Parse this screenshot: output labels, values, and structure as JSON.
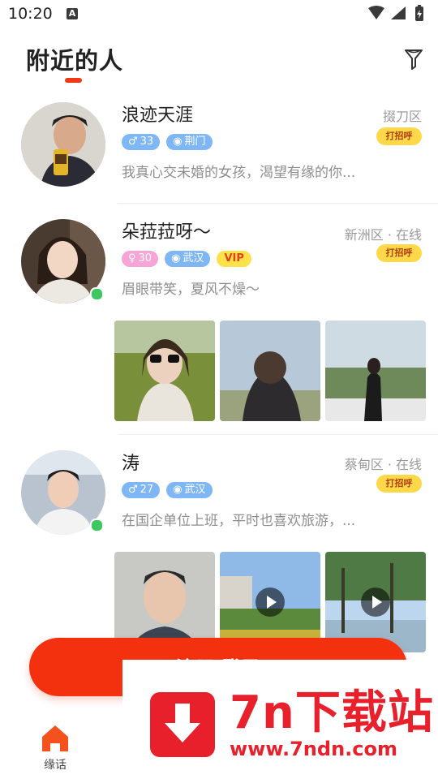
{
  "status_bar": {
    "time": "10:20"
  },
  "header": {
    "title": "附近的人"
  },
  "users": [
    {
      "name": "浪迹天涯",
      "location": "掇刀区",
      "greet_label": "打招呼",
      "gender_symbol": "♂",
      "age": "33",
      "city": "荆门",
      "bio": "我真心交未婚的女孩，渴望有缘的你..."
    },
    {
      "name": "朵菈菈呀～",
      "location": "新洲区 · 在线",
      "greet_label": "打招呼",
      "gender_symbol": "♀",
      "age": "30",
      "city": "武汉",
      "vip": "VIP",
      "bio": "眉眼带笑，夏风不燥～"
    },
    {
      "name": "涛",
      "location": "蔡甸区 · 在线",
      "greet_label": "打招呼",
      "gender_symbol": "♂",
      "age": "27",
      "city": "武汉",
      "bio": "在国企单位上班，平时也喜欢旅游，..."
    }
  ],
  "cta": {
    "label": "注册/登录"
  },
  "tabbar": {
    "home_label": "缘话"
  },
  "watermark": {
    "title": "7n下载站",
    "url": "www.7ndn.com"
  },
  "colors": {
    "accent": "#f03a17",
    "greet_bg": "#ffd84a",
    "online": "#3dc761",
    "male_tag": "#7fb6f6",
    "female_tag": "#f7a4d6"
  }
}
